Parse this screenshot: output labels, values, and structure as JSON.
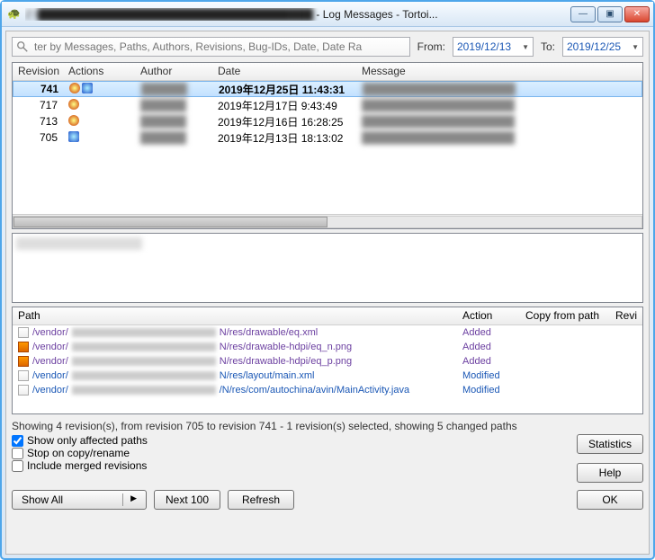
{
  "titlebar": {
    "prefix_blurred": "Z:\\████████████████████████████████████",
    "suffix": " - Log Messages - Tortoi..."
  },
  "winbuttons": {
    "min": "—",
    "max": "▣",
    "close": "✕"
  },
  "search": {
    "placeholder": "ter by Messages, Paths, Authors, Revisions, Bug-IDs, Date, Date Ra"
  },
  "dates": {
    "from_label": "From:",
    "to_label": "To:",
    "from": "2019/12/13",
    "to": "2019/12/25"
  },
  "columns": {
    "revision": "Revision",
    "actions": "Actions",
    "author": "Author",
    "date": "Date",
    "message": "Message"
  },
  "rows": [
    {
      "rev": "741",
      "date": "2019年12月25日 11:43:31",
      "actions": [
        "red",
        "blue"
      ],
      "selected": true
    },
    {
      "rev": "717",
      "date": "2019年12月17日 9:43:49",
      "actions": [
        "red"
      ]
    },
    {
      "rev": "713",
      "date": "2019年12月16日 16:28:25",
      "actions": [
        "red"
      ]
    },
    {
      "rev": "705",
      "date": "2019年12月13日 18:13:02",
      "actions": [
        "blue"
      ]
    }
  ],
  "pathcols": {
    "path": "Path",
    "action": "Action",
    "copy": "Copy from path",
    "rev": "Revi"
  },
  "paths": [
    {
      "suffix": "N/res/drawable/eq.xml",
      "action": "Added",
      "icon": "txt"
    },
    {
      "suffix": "N/res/drawable-hdpi/eq_n.png",
      "action": "Added",
      "icon": "img"
    },
    {
      "suffix": "N/res/drawable-hdpi/eq_p.png",
      "action": "Added",
      "icon": "img"
    },
    {
      "suffix": "N/res/layout/main.xml",
      "action": "Modified",
      "icon": "txt"
    },
    {
      "suffix": "/N/res/com/autochina/avin/MainActivity.java",
      "action": "Modified",
      "icon": "txt"
    }
  ],
  "pathprefix": "/vendor/",
  "status": "Showing 4 revision(s), from revision 705 to revision 741 - 1 revision(s) selected, showing 5 changed paths",
  "checks": {
    "affected": "Show only affected paths",
    "stop": "Stop on copy/rename",
    "merged": "Include merged revisions"
  },
  "buttons": {
    "showall": "Show All",
    "next100": "Next 100",
    "refresh": "Refresh",
    "stats": "Statistics",
    "help": "Help",
    "ok": "OK"
  }
}
